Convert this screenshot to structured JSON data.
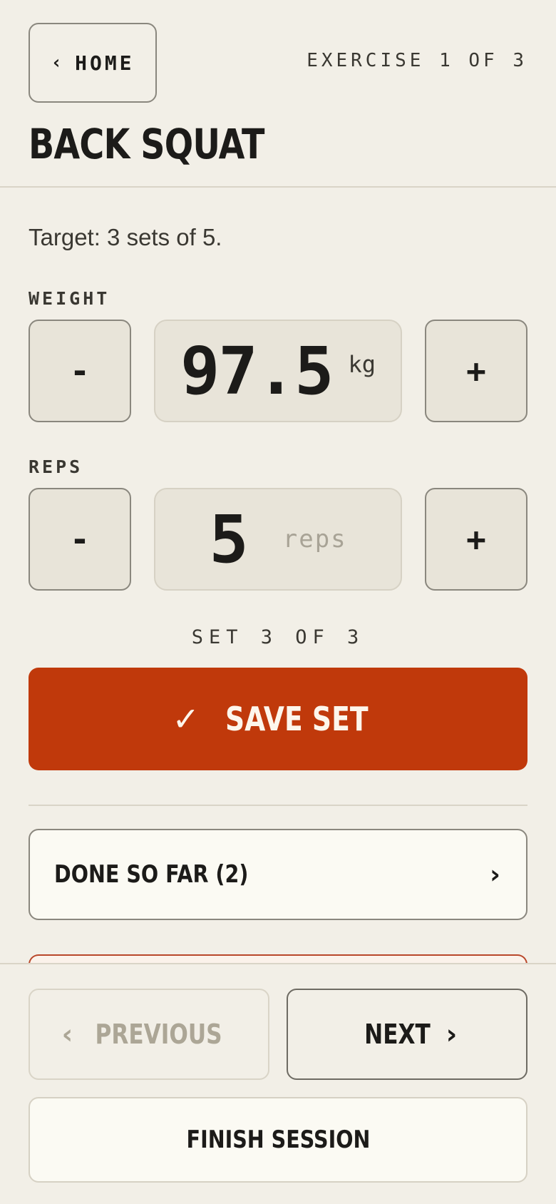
{
  "header": {
    "home_chevron": "‹",
    "home_label": "HOME",
    "progress": "EXERCISE 1 OF 3",
    "title": "BACK SQUAT"
  },
  "target": "Target: 3 sets of 5.",
  "weight": {
    "label": "WEIGHT",
    "decrement": "-",
    "value": "97.5",
    "unit": "kg",
    "increment": "+"
  },
  "reps": {
    "label": "REPS",
    "decrement": "-",
    "value": "5",
    "unit": "reps",
    "increment": "+"
  },
  "set_counter": "SET 3 OF 3",
  "save": {
    "check": "✓",
    "label": "SAVE SET",
    "color": "#c0390b"
  },
  "done_so_far": {
    "label": "DONE SO FAR (2)",
    "chevron": "›"
  },
  "footer": {
    "previous_chevron": "‹",
    "previous_label": "PREVIOUS",
    "next_label": "NEXT",
    "next_chevron": "›",
    "finish_label": "FINISH SESSION"
  },
  "colors": {
    "background": "#f2efe7",
    "accent": "#c0390b",
    "disabled": "#aca696"
  }
}
